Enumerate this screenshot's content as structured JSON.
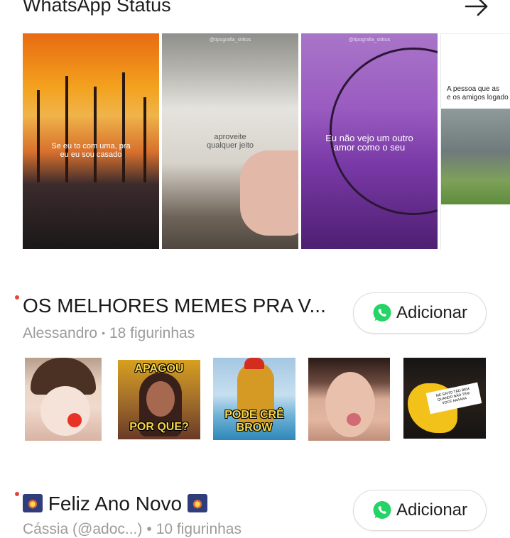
{
  "header": {
    "title": "WhatsApp Status",
    "arrow_icon": "arrow-right-icon"
  },
  "status_thumbnails": [
    {
      "caption": "Se eu to com uma, pra\neu eu sou casado",
      "watermark": ""
    },
    {
      "caption": "aproveite\nqualquer jeito",
      "watermark": "@tipografia_st4tus"
    },
    {
      "caption": "Eu não vejo um outro\namor como o seu",
      "watermark": "@tipografia_st4tus"
    },
    {
      "caption": "A pessoa que as\ne os amigos logado",
      "watermark": ""
    }
  ],
  "packs": [
    {
      "title": "OS MELHORES MEMES PRA V...",
      "author": "Alessandro",
      "count": "18 figurinhas",
      "add_label": "Adicionar",
      "stickers": [
        {
          "icon": "baby-clown-sticker"
        },
        {
          "icon": "apagou-sticker",
          "top_text": "APAGOU",
          "bottom_text": "POR QUE?"
        },
        {
          "icon": "rooster-sticker",
          "bottom_text": "PODE CRÊ\nBROW"
        },
        {
          "icon": "tongue-girl-sticker"
        },
        {
          "icon": "yellow-hand-note-sticker",
          "note_text": "ME SINTO TÃO BEM\nQUANDO NÃO TEM\nVOCE AAAAAA"
        }
      ]
    },
    {
      "title": "Feliz Ano Novo",
      "author": "Cássia (@adoc...)",
      "count": "10 figurinhas",
      "add_label": "Adicionar"
    }
  ],
  "colors": {
    "whatsapp_green": "#25D366",
    "new_dot": "#E4453A",
    "subtitle_gray": "#9B9B9B"
  }
}
